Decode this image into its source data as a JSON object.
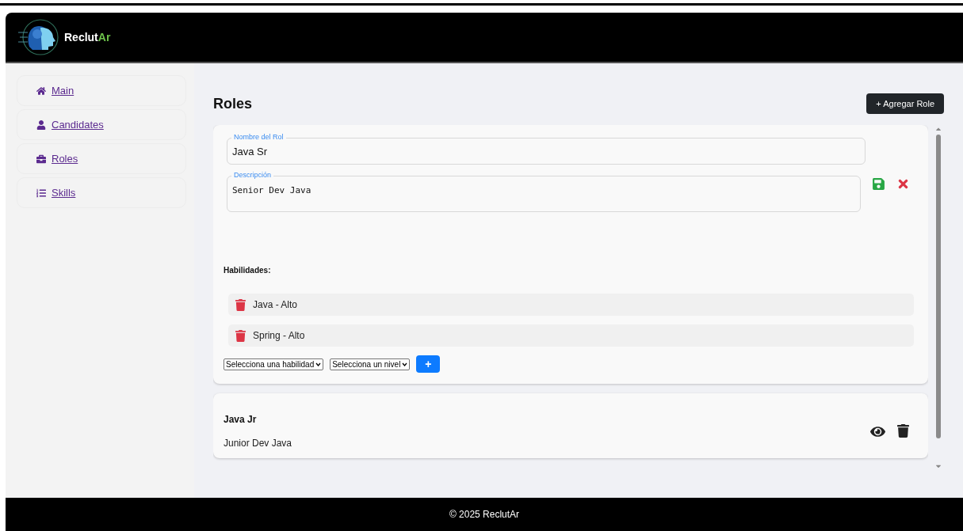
{
  "header": {
    "brand": "Reclut",
    "brand_accent": "Ar"
  },
  "sidebar": {
    "items": [
      {
        "label": "Main"
      },
      {
        "label": "Candidates"
      },
      {
        "label": "Roles"
      },
      {
        "label": "Skills"
      }
    ]
  },
  "page": {
    "title": "Roles",
    "add_button": "+ Agregar Role"
  },
  "roles": [
    {
      "kind": "editing",
      "name_label": "Nombre del Rol",
      "name": "Java Sr",
      "description_label": "Descripción",
      "description": "Senior Dev Java",
      "skills_heading": "Habilidades:",
      "skills": [
        {
          "label": "Java - Alto"
        },
        {
          "label": "Spring - Alto"
        }
      ],
      "skill_select": "Selecciona una habilidad",
      "level_select": "Selecciona un nivel",
      "add_skill_button": "+"
    },
    {
      "kind": "view",
      "name": "Java Jr",
      "description": "Junior Dev Java"
    }
  ],
  "footer": {
    "text": "© 2025 ReclutAr"
  }
}
